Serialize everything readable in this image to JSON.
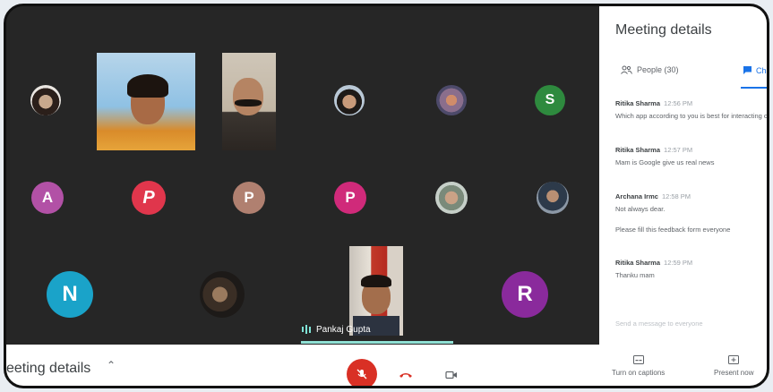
{
  "meeting": {
    "grid": {
      "participants": [
        {
          "initial": "A",
          "color": "#b251a6"
        },
        {
          "initial": "P",
          "color": "#e0364c"
        },
        {
          "initial": "P",
          "color": "#b08070"
        },
        {
          "initial": "P",
          "color": "#d02a7a"
        },
        {
          "initial": "S",
          "color": "#2e8a3e"
        },
        {
          "initial": "N",
          "color": "#1aa3c9"
        },
        {
          "initial": "R",
          "color": "#8a2a9c"
        }
      ],
      "active_speaker": "Pankaj Gupta"
    },
    "panel": {
      "title": "Meeting details",
      "tabs": {
        "people": "People (30)",
        "chat": "Chat"
      },
      "messages": [
        {
          "sender": "Ritika Sharma",
          "time": "12:56 PM",
          "lines": [
            "Which app according to you is best for interacting online"
          ]
        },
        {
          "sender": "Ritika Sharma",
          "time": "12:57 PM",
          "lines": [
            "Mam is Google give us real news"
          ]
        },
        {
          "sender": "Archana Irmc",
          "time": "12:58 PM",
          "lines": [
            "Not always dear.",
            "Please fill this feedback form everyone"
          ]
        },
        {
          "sender": "Ritika Sharma",
          "time": "12:59 PM",
          "lines": [
            "Thanku mam"
          ]
        }
      ],
      "input_placeholder": "Send a message to everyone"
    },
    "bottom": {
      "details_label": "eeting details",
      "captions_label": "Turn on captions",
      "present_label": "Present now"
    }
  },
  "colors": {
    "accent": "#1a73e8",
    "mic_off": "#d93025",
    "hangup": "#d93025",
    "speaker_line": "#8fe0d4"
  }
}
